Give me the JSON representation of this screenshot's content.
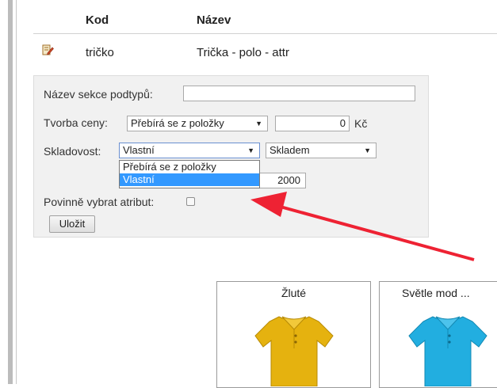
{
  "table": {
    "headers": {
      "kod": "Kod",
      "nazev": "Název"
    },
    "row": {
      "icon": "edit-icon",
      "kod": "tričko",
      "nazev": "Trička - polo - attr"
    }
  },
  "form": {
    "section_name_label": "Název sekce podtypů:",
    "section_name_value": "",
    "price_label": "Tvorba ceny:",
    "price_select": "Přebírá se z položky",
    "price_value": "0",
    "currency": "Kč",
    "stock_label": "Skladovost:",
    "stock_select": "Vlastní",
    "stock_status_select": "Skladem",
    "stock_options": [
      "Přebírá se z položky",
      "Vlastní"
    ],
    "stock_quantity": "2000",
    "required_label": "Povinně vybrat atribut:",
    "save_button": "Uložit"
  },
  "products": [
    {
      "name": "Žluté",
      "color": "#e5b20f"
    },
    {
      "name": "Světle mod ...",
      "color": "#22aee0"
    }
  ],
  "annotation": {
    "arrow_color": "#ee2233"
  }
}
